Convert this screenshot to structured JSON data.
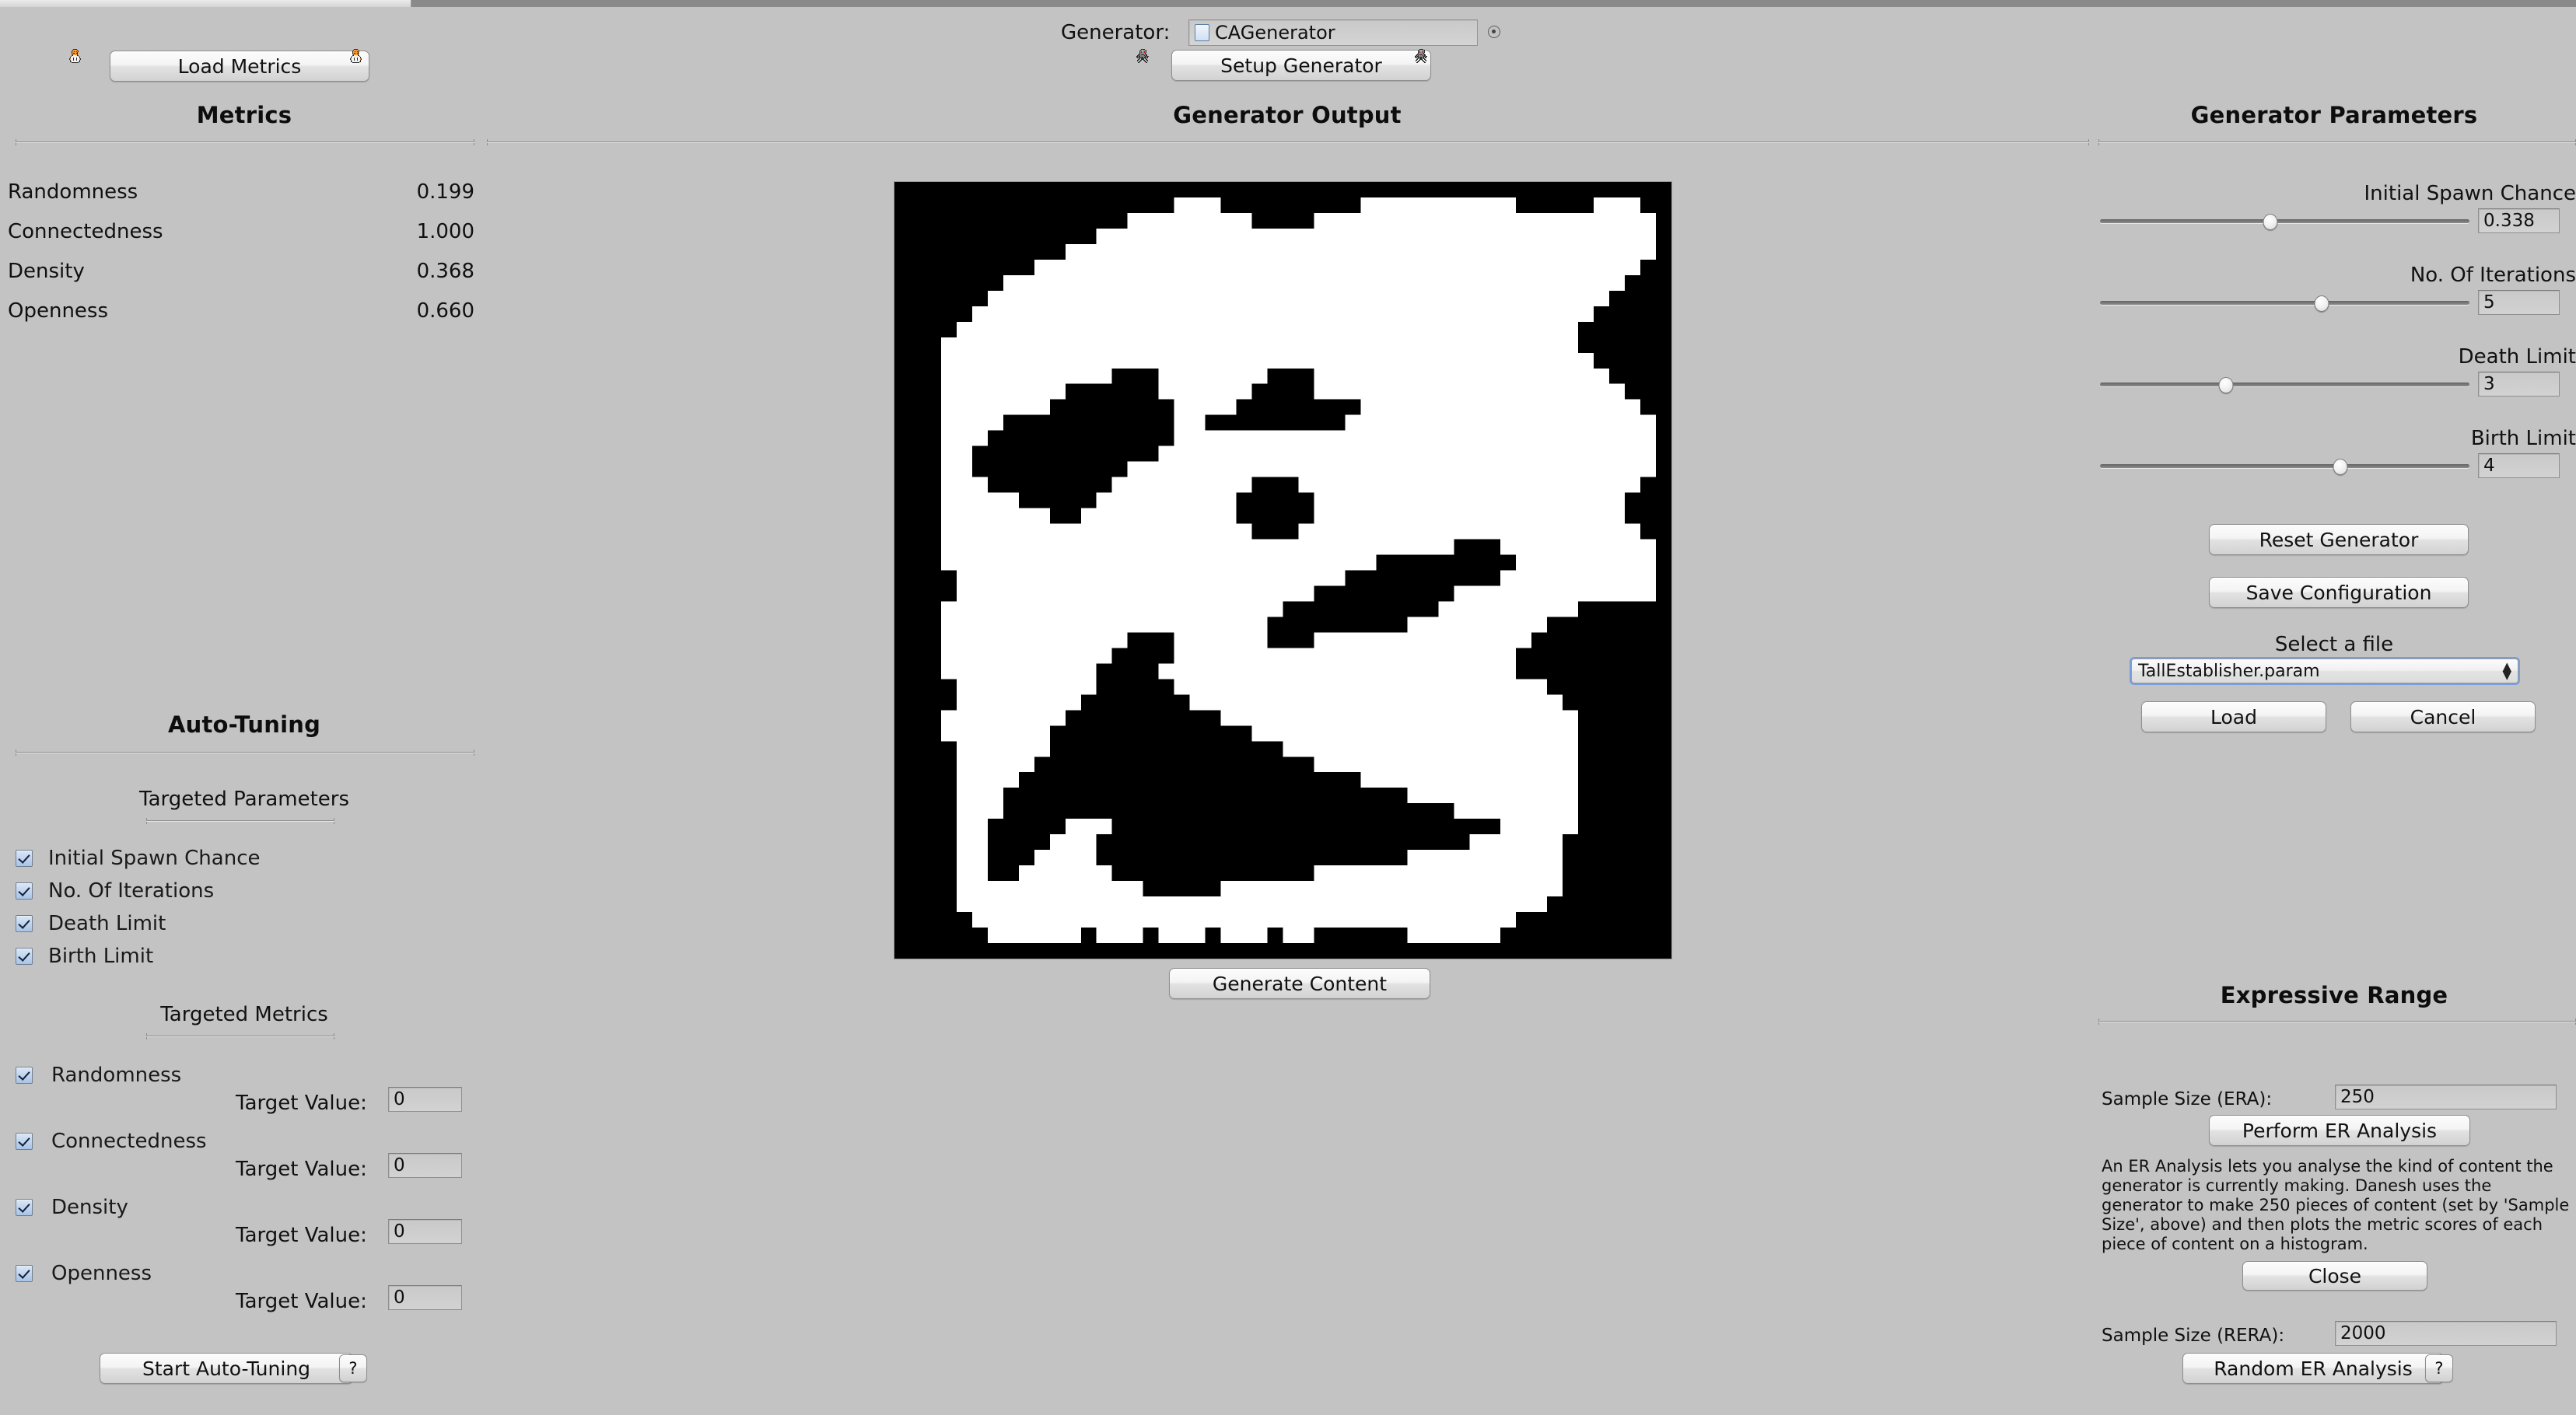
{
  "window": {
    "accent": "#7a9ddb",
    "background": "#c3c3c3"
  },
  "header": {
    "generator_label": "Generator:",
    "generator_value": "CAGenerator",
    "generator_icon": "file-icon",
    "setup_button": "Setup Generator",
    "options_icon": "radio-options-icon"
  },
  "metrics_panel": {
    "load_button": "Load Metrics",
    "title": "Metrics",
    "rows": [
      {
        "name": "Randomness",
        "value": "0.199"
      },
      {
        "name": "Connectedness",
        "value": "1.000"
      },
      {
        "name": "Density",
        "value": "0.368"
      },
      {
        "name": "Openness",
        "value": "0.660"
      }
    ]
  },
  "output_panel": {
    "title": "Generator Output",
    "generate_button": "Generate Content"
  },
  "autotuning": {
    "title": "Auto-Tuning",
    "targeted_parameters_title": "Targeted Parameters",
    "parameters": [
      {
        "label": "Initial Spawn Chance",
        "checked": true
      },
      {
        "label": "No. Of Iterations",
        "checked": true
      },
      {
        "label": "Death Limit",
        "checked": true
      },
      {
        "label": "Birth Limit",
        "checked": true
      }
    ],
    "targeted_metrics_title": "Targeted Metrics",
    "metrics": [
      {
        "label": "Randomness",
        "checked": true,
        "target_label": "Target Value:",
        "target_value": "0"
      },
      {
        "label": "Connectedness",
        "checked": true,
        "target_label": "Target Value:",
        "target_value": "0"
      },
      {
        "label": "Density",
        "checked": true,
        "target_label": "Target Value:",
        "target_value": "0"
      },
      {
        "label": "Openness",
        "checked": true,
        "target_label": "Target Value:",
        "target_value": "0"
      }
    ],
    "start_button": "Start Auto-Tuning",
    "help_button": "?"
  },
  "generator_parameters": {
    "title": "Generator Parameters",
    "sliders": [
      {
        "label": "Initial Spawn Chance",
        "value": "0.338",
        "thumb_pct": 46
      },
      {
        "label": "No. Of Iterations",
        "value": "5",
        "thumb_pct": 60
      },
      {
        "label": "Death Limit",
        "value": "3",
        "thumb_pct": 34
      },
      {
        "label": "Birth Limit",
        "value": "4",
        "thumb_pct": 65
      }
    ],
    "reset_button": "Reset Generator",
    "save_button": "Save Configuration",
    "select_file_label": "Select a file",
    "selected_file": "TallEstablisher.param",
    "load_button": "Load",
    "cancel_button": "Cancel"
  },
  "expressive_range": {
    "title": "Expressive Range",
    "era_label": "Sample Size (ERA):",
    "era_value": "250",
    "perform_button": "Perform ER Analysis",
    "description": "An ER Analysis lets you analyse the kind of content the generator is currently making. Danesh uses the generator to make 250 pieces of content (set by 'Sample Size', above) and then plots the metric scores of each piece of content on a histogram.",
    "close_button": "Close",
    "rera_label": "Sample Size (RERA):",
    "rera_value": "2000",
    "random_button": "Random ER Analysis",
    "help_button": "?"
  },
  "ca_grid": {
    "cols": 50,
    "rows": 50,
    "wall_color": "#000000",
    "floor_color": "#ffffff",
    "rows_data": [
      "00000000000000000000000000000000000000000000000000",
      "00000000000000000011100000000011111111110000011100",
      "00000000000000011111111000011111111111111111111110",
      "00000000000001111111111111111111111111111111111110",
      "00000000000111111111111111111111111111111111111110",
      "00000000011111111111111111111111111111111111111100",
      "00000001111111111111111111111111111111111111111000",
      "00000011111111111111111111111111111111111111110000",
      "00000111111111111111111111111111111111111111100000",
      "00001111111111111111111111111111111111111111000000",
      "00011111111111111111111111111111111111111111000000",
      "00011111111111111111111111111111111111111111100000",
      "00011111111111000111111100011111111111111111110000",
      "00011111111000000111111000011111111111111111111000",
      "00011111110000000011110000000011111111111111111100",
      "00011110000000000011000000000111111111111111111110",
      "00011100000000000011111111111111111111111111111110",
      "00011000000000000111111111111111111111111111111110",
      "00011000000000011111111111111111111111111111111110",
      "00011100000000111111111000111111111111111111111100",
      "00011111000001111111110000011111111111111111111000",
      "00011111110011111111110000011111111111111111111000",
      "00011111111111111111111000111111111111111111111100",
      "00011111111111111111111111111111111100011111111110",
      "00011111111111111111111111111110000000001111111110",
      "00001111111111111111111111111000000000011111111110",
      "00001111111111111111111111100000000011111111111110",
      "00011111111111111111111110000000000111111111000000",
      "00011111111111111111111100000000011111111100000000",
      "00011111111111100011111100011111111111111000000000",
      "00011111111111000011111111111111111111110000000000",
      "00011111111110000111111111111111111111110000000000",
      "00001111111110000011111111111111111111111100000000",
      "00001111111100000001111111111111111111111110000000",
      "00011111111000000000011111111111111111111111000000",
      "00011111110000000000000111111111111111111111000000",
      "00001111110000000000000001111111111111111111000000",
      "00001111100000000000000000011111111111111111000000",
      "00001111000000000000000000000011111111111111000000",
      "00001110000000000000000000000000011111111111000000",
      "00001110000000000000000000000000000011111111000000",
      "00001100000111000000000000000000000000011111000000",
      "00001100001110000000000000000000000001111110000000",
      "00001100011110000000000000000000011111111110000000",
      "00001100111111000000000000011111111111111110000000",
      "00001111111111110000011111111111111111111110000000",
      "00001111111111111111111111111111111111111100000000",
      "00000111111111111111111111111111111111110000000000",
      "00000011111101110111011101100000011111100000000000",
      "00000000000000000000000000000000000000000000000000"
    ]
  }
}
